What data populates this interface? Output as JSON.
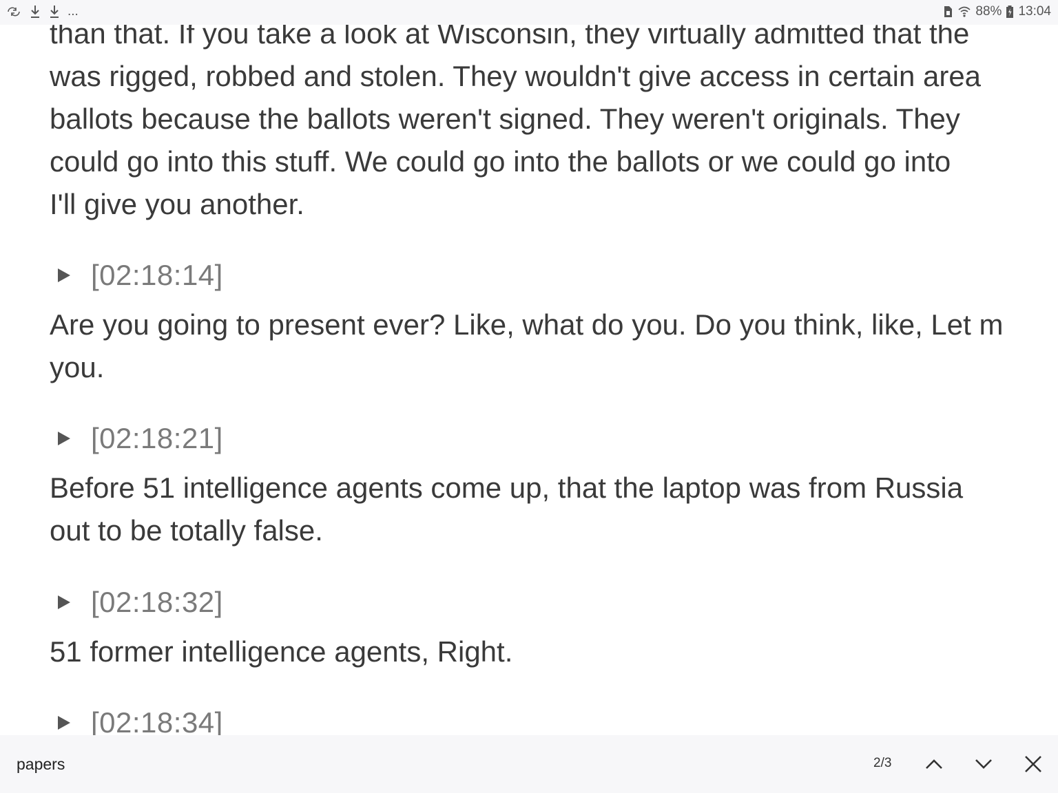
{
  "status_bar": {
    "left_icons": [
      "sync-icon",
      "download-icon",
      "download-icon",
      "more-notifications-icon"
    ],
    "more_indicator": "...",
    "battery_percent": "88%",
    "time": "13:04"
  },
  "transcript": {
    "top_paragraph": [
      "than that. If you take a look at Wisconsin, they virtually admitted that the",
      "was rigged, robbed and stolen. They wouldn't give access in certain area",
      "ballots because the ballots weren't signed. They weren't originals. They",
      "could go into this stuff. We could go into the ballots or we could go into",
      "I'll give you another."
    ],
    "entries": [
      {
        "timestamp": "[02:18:14]",
        "lines": [
          "Are you going to present ever? Like, what do you. Do you think, like, Let m",
          "you."
        ]
      },
      {
        "timestamp": "[02:18:21]",
        "lines": [
          "Before 51 intelligence agents come up, that the laptop was from Russia",
          "out to be totally false."
        ]
      },
      {
        "timestamp": "[02:18:32]",
        "lines": [
          "51 former intelligence agents, Right."
        ]
      },
      {
        "timestamp": "[02:18:34]",
        "lines": []
      }
    ]
  },
  "find_bar": {
    "query": "papers",
    "match_count": "2/3",
    "prev_icon": "chevron-up-icon",
    "next_icon": "chevron-down-icon",
    "close_icon": "close-icon"
  },
  "colors": {
    "body_text": "#3a3a3a",
    "timestamp_text": "#7a7a7a",
    "bar_background": "#f7f7f9",
    "icon": "#555555"
  }
}
